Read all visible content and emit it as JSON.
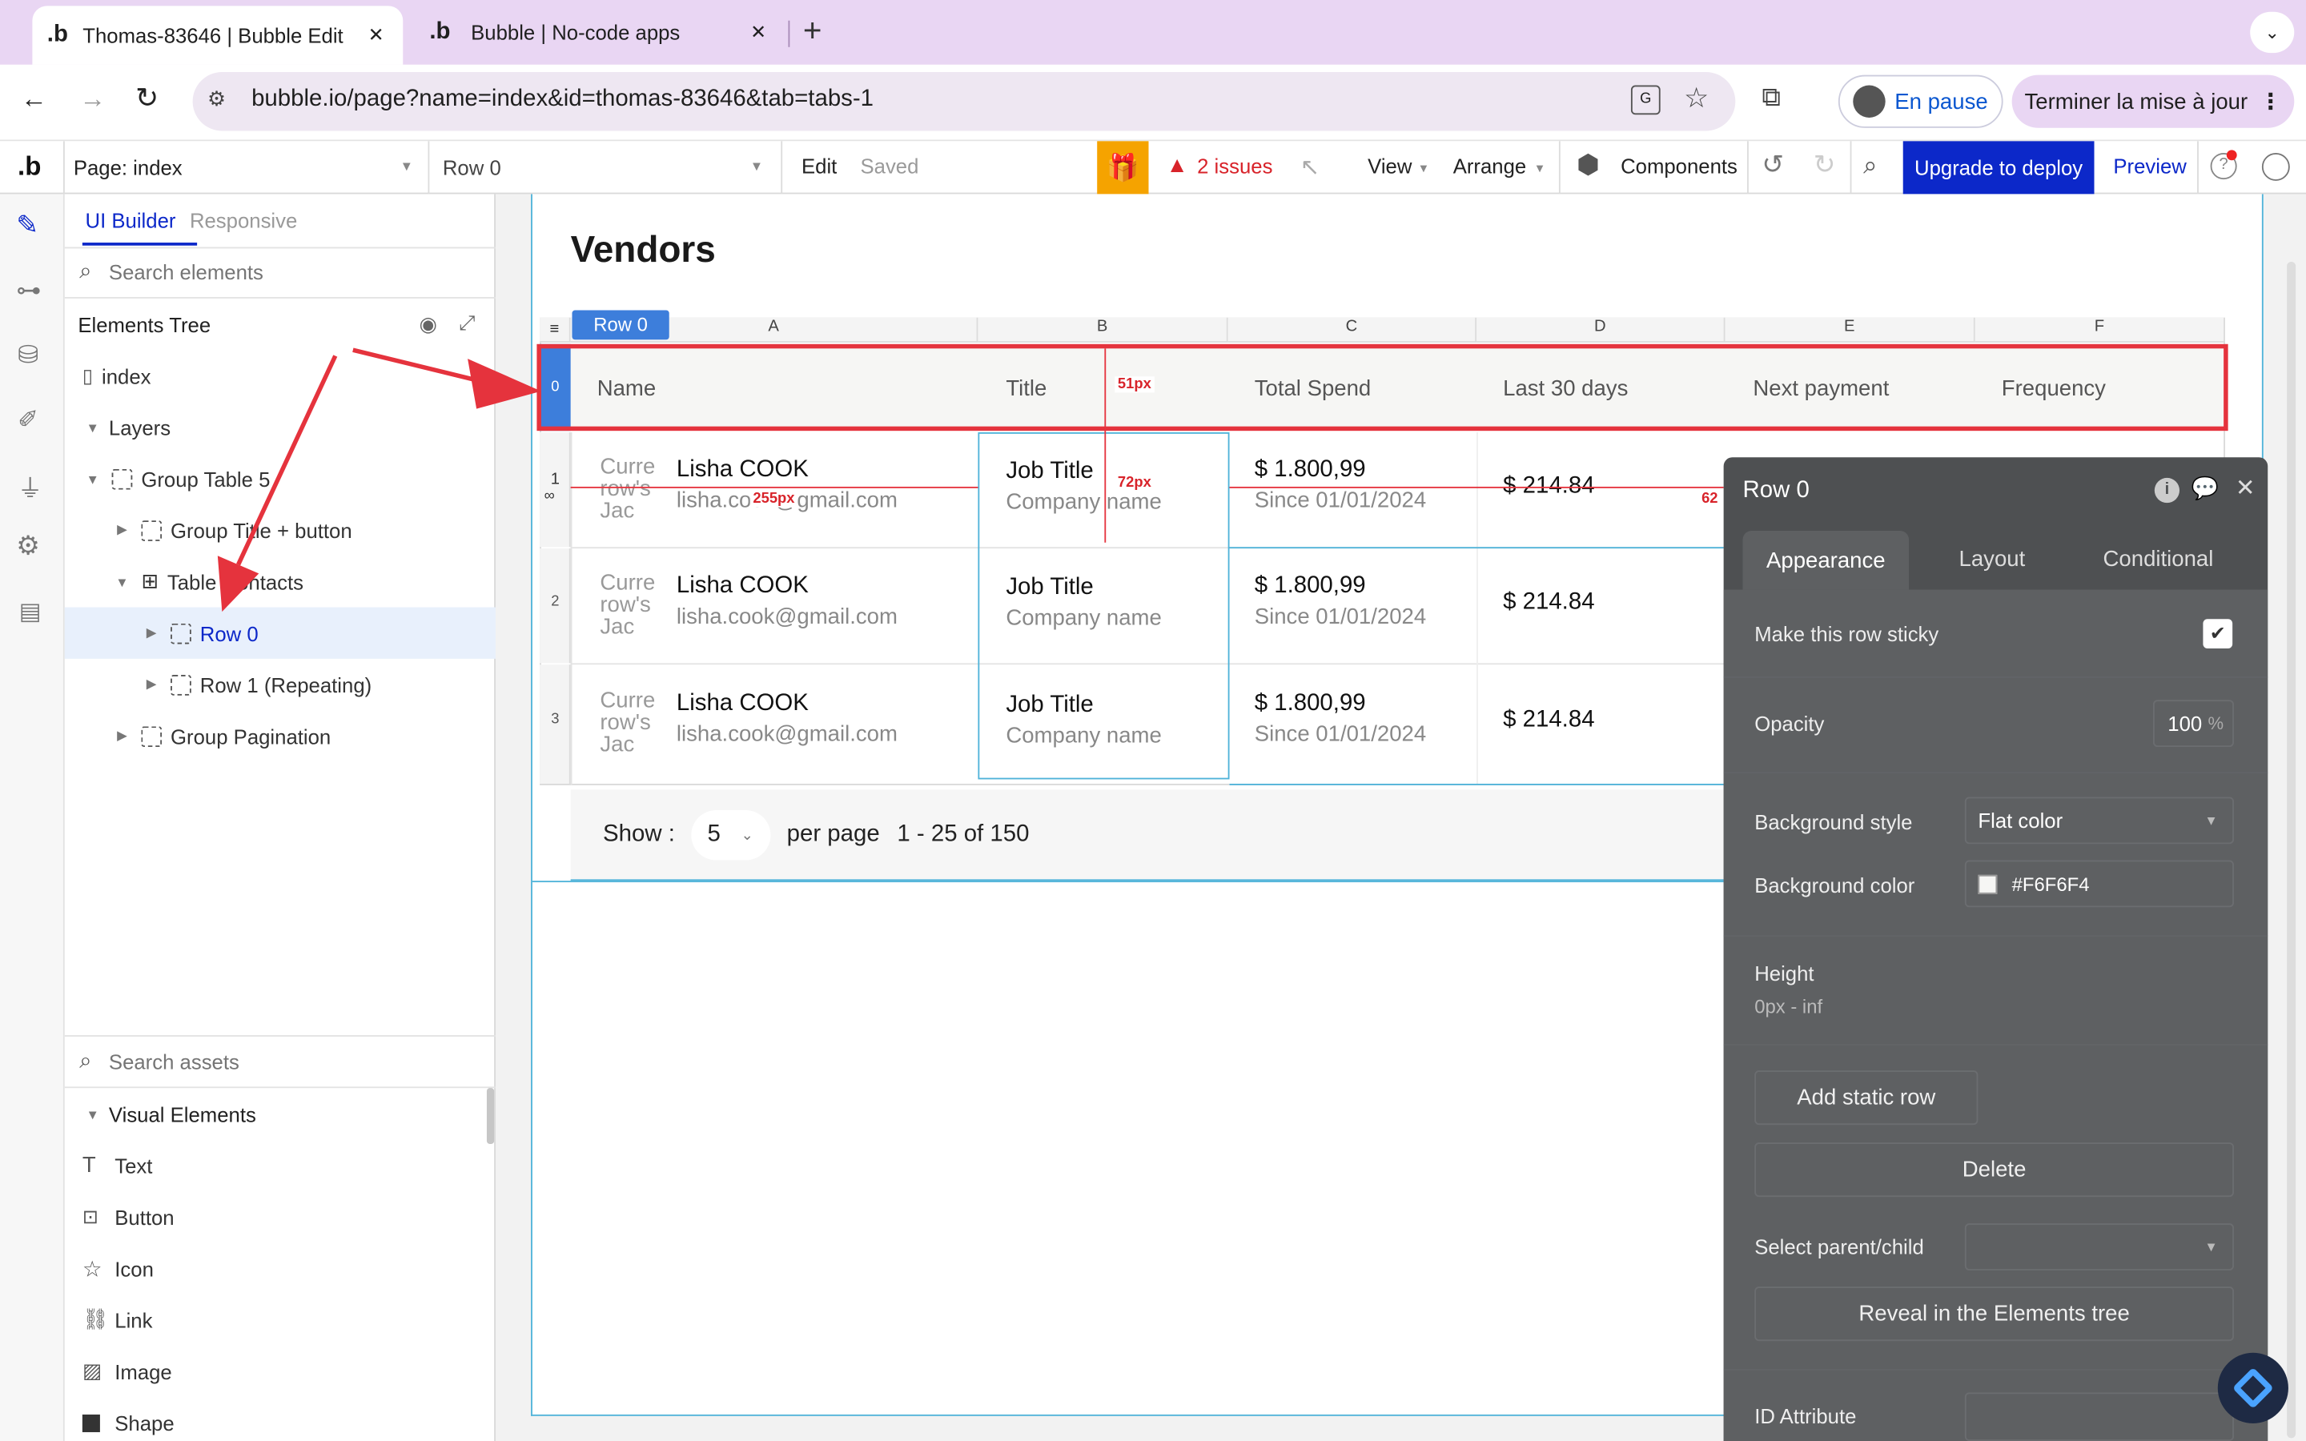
{
  "browser": {
    "tabs": [
      {
        "title": "Thomas-83646 | Bubble Edit",
        "close": "✕"
      },
      {
        "title": "Bubble | No-code apps",
        "close": "✕"
      }
    ],
    "new_tab": "+",
    "url": "bubble.io/page?name=index&id=thomas-83646&tab=tabs-1",
    "profile_label": "En pause",
    "update_label": "Terminer la mise à jour"
  },
  "editor_header": {
    "logo": ".b",
    "page_select": "Page: index",
    "element_select": "Row 0",
    "edit_label": "Edit",
    "saved_label": "Saved",
    "issues_label": "2 issues",
    "view_label": "View",
    "arrange_label": "Arrange",
    "components_label": "Components",
    "upgrade_label": "Upgrade to deploy",
    "preview_label": "Preview"
  },
  "left_panel": {
    "tab_builder": "UI Builder",
    "tab_responsive": "Responsive",
    "search_elements_placeholder": "Search elements",
    "tree_title": "Elements Tree",
    "tree": {
      "index": "index",
      "layers": "Layers",
      "group_table": "Group Table 5",
      "group_title": "Group Title + button",
      "table_contacts": "Table Contacts",
      "row0": "Row 0",
      "row1": "Row 1 (Repeating)",
      "group_pagination": "Group Pagination"
    },
    "search_assets_placeholder": "Search assets",
    "visual_title": "Visual Elements",
    "visual_items": [
      "Text",
      "Button",
      "Icon",
      "Link",
      "Image",
      "Shape"
    ]
  },
  "canvas": {
    "page_heading": "Vendors",
    "row_tag": "Row 0",
    "columns": [
      "A",
      "B",
      "C",
      "D",
      "E",
      "F"
    ],
    "header_row": {
      "index": "0",
      "cells": [
        "Name",
        "Title",
        "Total Spend",
        "Last 30 days",
        "Next payment",
        "Frequency"
      ]
    },
    "rows": [
      {
        "index": "1",
        "placeholder": "Curre row's Jac",
        "name": "Lisha COOK",
        "email": "lisha.cook@gmail.com",
        "title": "Job Title",
        "company": "Company name",
        "spend": "$ 1.800,99",
        "since": "Since 01/01/2024",
        "last30": "$ 214.84"
      },
      {
        "index": "2",
        "placeholder": "Curre row's Jac",
        "name": "Lisha COOK",
        "email": "lisha.cook@gmail.com",
        "title": "Job Title",
        "company": "Company name",
        "spend": "$ 1.800,99",
        "since": "Since 01/01/2024",
        "last30": "$ 214.84"
      },
      {
        "index": "3",
        "placeholder": "Curre row's Jac",
        "name": "Lisha COOK",
        "email": "lisha.cook@gmail.com",
        "title": "Job Title",
        "company": "Company name",
        "spend": "$ 1.800,99",
        "since": "Since 01/01/2024",
        "last30": "$ 214.84"
      }
    ],
    "measure_labels": [
      "51px",
      "72px",
      "255px",
      "62"
    ],
    "pagination": {
      "show_label": "Show :",
      "per_page_value": "5",
      "per_page_label": "per page",
      "range": "1 - 25 of 150"
    }
  },
  "property_editor": {
    "title": "Row 0",
    "tabs": [
      "Appearance",
      "Layout",
      "Conditional"
    ],
    "sticky_label": "Make this row sticky",
    "opacity_label": "Opacity",
    "opacity_value": "100",
    "opacity_unit": "%",
    "bg_style_label": "Background style",
    "bg_style_value": "Flat color",
    "bg_color_label": "Background color",
    "bg_color_value": "#F6F6F4",
    "height_label": "Height",
    "height_value": "0px - inf",
    "add_static_row": "Add static row",
    "delete_label": "Delete",
    "select_parent_label": "Select parent/child",
    "reveal_label": "Reveal in the Elements tree",
    "id_attr_label": "ID Attribute"
  },
  "colors": {
    "accent_blue": "#0c28c9",
    "annotation_red": "#e5333d",
    "selected_blue": "#3d7edb",
    "gift_orange": "#f5a300"
  }
}
